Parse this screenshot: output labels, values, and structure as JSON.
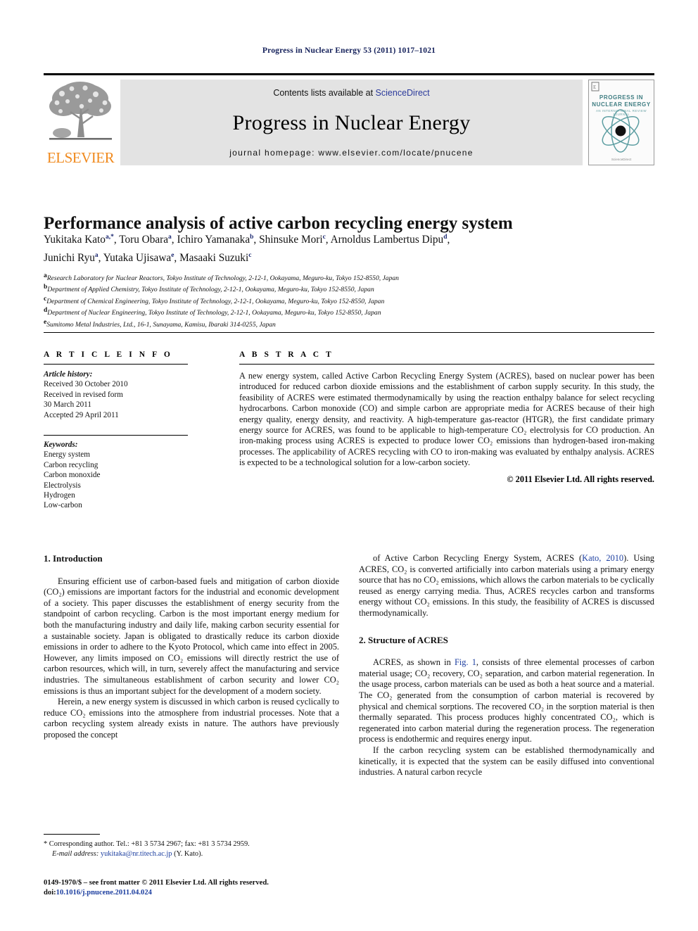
{
  "running_head": "Progress in Nuclear Energy 53 (2011) 1017–1021",
  "masthead": {
    "publisher_name": "ELSEVIER",
    "contents_prefix": "Contents lists available at ",
    "sciencedirect_label": "ScienceDirect",
    "journal_name": "Progress in Nuclear Energy",
    "homepage_line": "journal homepage: www.elsevier.com/locate/pnucene",
    "cover": {
      "title_line1": "PROGRESS IN",
      "title_line2": "NUCLEAR ENERGY",
      "subtitle": "AN INTERNATIONAL REVIEW JOURNAL",
      "footer": "ScienceDirect"
    },
    "colors": {
      "elsevier_orange": "#f08a1e",
      "link_blue": "#2b3a9b",
      "band_gray": "#e3e3e3",
      "cover_teal": "#3f7d82"
    }
  },
  "article": {
    "title": "Performance analysis of active carbon recycling energy system",
    "authors_line1_parts": [
      {
        "name": "Yukitaka Kato",
        "mark": "a,*",
        "sep": ", "
      },
      {
        "name": "Toru Obara",
        "mark": "a",
        "sep": ", "
      },
      {
        "name": "Ichiro Yamanaka",
        "mark": "b",
        "sep": ", "
      },
      {
        "name": "Shinsuke Mori",
        "mark": "c",
        "sep": ", "
      },
      {
        "name": "Arnoldus Lambertus Dipu",
        "mark": "d",
        "sep": ","
      }
    ],
    "authors_line2_parts": [
      {
        "name": "Junichi Ryu",
        "mark": "a",
        "sep": ", "
      },
      {
        "name": "Yutaka Ujisawa",
        "mark": "e",
        "sep": ", "
      },
      {
        "name": "Masaaki Suzuki",
        "mark": "c",
        "sep": ""
      }
    ],
    "affiliations": [
      {
        "mark": "a",
        "text": "Research Laboratory for Nuclear Reactors, Tokyo Institute of Technology, 2-12-1, Ookayama, Meguro-ku, Tokyo 152-8550, Japan"
      },
      {
        "mark": "b",
        "text": "Department of Applied Chemistry, Tokyo Institute of Technology, 2-12-1, Ookayama, Meguro-ku, Tokyo 152-8550, Japan"
      },
      {
        "mark": "c",
        "text": "Department of Chemical Engineering, Tokyo Institute of Technology, 2-12-1, Ookayama, Meguro-ku, Tokyo 152-8550, Japan"
      },
      {
        "mark": "d",
        "text": "Department of Nuclear Engineering, Tokyo Institute of Technology, 2-12-1, Ookayama, Meguro-ku, Tokyo 152-8550, Japan"
      },
      {
        "mark": "e",
        "text": "Sumitomo Metal Industries, Ltd., 16-1, Sunayama, Kamisu, Ibaraki 314-0255, Japan"
      }
    ]
  },
  "article_info": {
    "heading": "A R T I C L E   I N F O",
    "history_label": "Article history:",
    "history": [
      "Received 30 October 2010",
      "Received in revised form",
      "30 March 2011",
      "Accepted 29 April 2011"
    ],
    "keywords_label": "Keywords:",
    "keywords": [
      "Energy system",
      "Carbon recycling",
      "Carbon monoxide",
      "Electrolysis",
      "Hydrogen",
      "Low-carbon"
    ]
  },
  "abstract": {
    "heading": "A B S T R A C T",
    "text": "A new energy system, called Active Carbon Recycling Energy System (ACRES), based on nuclear power has been introduced for reduced carbon dioxide emissions and the establishment of carbon supply security. In this study, the feasibility of ACRES were estimated thermodynamically by using the reaction enthalpy balance for select recycling hydrocarbons. Carbon monoxide (CO) and simple carbon are appropriate media for ACRES because of their high energy quality, energy density, and reactivity. A high-temperature gas-reactor (HTGR), the first candidate primary energy source for ACRES, was found to be applicable to high-temperature CO₂ electrolysis for CO production. An iron-making process using ACRES is expected to produce lower CO₂ emissions than hydrogen-based iron-making processes. The applicability of ACRES recycling with CO to iron-making was evaluated by enthalpy analysis. ACRES is expected to be a technological solution for a low-carbon society.",
    "copyright": "© 2011 Elsevier Ltd. All rights reserved."
  },
  "body": {
    "left": {
      "section_heading": "1. Introduction",
      "paragraph1": "Ensuring efficient use of carbon-based fuels and mitigation of carbon dioxide (CO₂) emissions are important factors for the industrial and economic development of a society. This paper discusses the establishment of energy security from the standpoint of carbon recycling. Carbon is the most important energy medium for both the manufacturing industry and daily life, making carbon security essential for a sustainable society. Japan is obligated to drastically reduce its carbon dioxide emissions in order to adhere to the Kyoto Protocol, which came into effect in 2005. However, any limits imposed on CO₂ emissions will directly restrict the use of carbon resources, which will, in turn, severely affect the manufacturing and service industries. The simultaneous establishment of carbon security and lower CO₂ emissions is thus an important subject for the development of a modern society.",
      "paragraph2": "Herein, a new energy system is discussed in which carbon is reused cyclically to reduce CO₂ emissions into the atmosphere from industrial processes. Note that a carbon recycling system already exists in nature. The authors have previously proposed the concept"
    },
    "right": {
      "paragraph1_pre": "of Active Carbon Recycling Energy System, ACRES (",
      "paragraph1_ref": "Kato, 2010",
      "paragraph1_post": "). Using ACRES, CO₂ is converted artificially into carbon materials using a primary energy source that has no CO₂ emissions, which allows the carbon materials to be cyclically reused as energy carrying media. Thus, ACRES recycles carbon and transforms energy without CO₂ emissions. In this study, the feasibility of ACRES is discussed thermodynamically.",
      "section_heading": "2. Structure of ACRES",
      "paragraph2_pre": "ACRES, as shown in ",
      "paragraph2_ref": "Fig. 1",
      "paragraph2_post": ", consists of three elemental processes of carbon material usage; CO₂ recovery, CO₂ separation, and carbon material regeneration. In the usage process, carbon materials can be used as both a heat source and a material. The CO₂ generated from the consumption of carbon material is recovered by physical and chemical sorptions. The recovered CO₂ in the sorption material is then thermally separated. This process produces highly concentrated CO₂, which is regenerated into carbon material during the regeneration process. The regeneration process is endothermic and requires energy input.",
      "paragraph3": "If the carbon recycling system can be established thermodynamically and kinetically, it is expected that the system can be easily diffused into conventional industries. A natural carbon recycle"
    }
  },
  "footnote": {
    "corresponding": "* Corresponding author. Tel.: +81 3 5734 2967; fax: +81 3 5734 2959.",
    "email_label": "E-mail address:",
    "email": "yukitaka@nr.titech.ac.jp",
    "email_owner": "(Y. Kato)."
  },
  "footer": {
    "front_matter": "0149-1970/$ – see front matter © 2011 Elsevier Ltd. All rights reserved.",
    "doi_label": "doi:",
    "doi": "10.1016/j.pnucene.2011.04.024"
  }
}
